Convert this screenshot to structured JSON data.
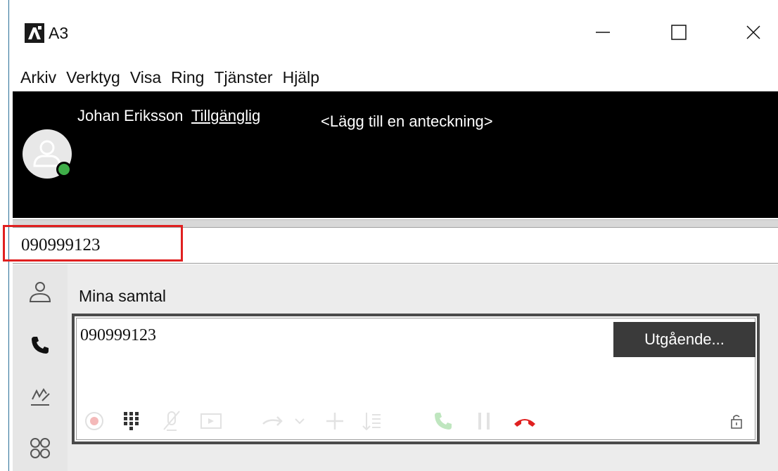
{
  "window": {
    "title": "A3",
    "controls": [
      "minimize-icon",
      "maximize-icon",
      "close-icon"
    ]
  },
  "menu": {
    "items": [
      {
        "label": "Arkiv"
      },
      {
        "label": "Verktyg"
      },
      {
        "label": "Visa"
      },
      {
        "label": "Ring"
      },
      {
        "label": "Tjänster"
      },
      {
        "label": "Hjälp"
      }
    ]
  },
  "user": {
    "name": "Johan Eriksson",
    "status": "Tillgänglig",
    "note_placeholder": "<Lägg till en anteckning>",
    "status_color": "#3fae49"
  },
  "dial": {
    "number": "090999123"
  },
  "nav": {
    "icons": [
      "contacts-icon",
      "phone-icon",
      "signature-icon",
      "groups-icon"
    ]
  },
  "calls": {
    "section_title": "Mina samtal",
    "items": [
      {
        "number": "090999123",
        "state": "Utgående..."
      }
    ],
    "toolbar_icons": [
      "record-icon",
      "dialpad-icon",
      "mute-icon",
      "screen-icon",
      "transfer-icon",
      "dropdown-icon",
      "add-call-icon",
      "merge-icon",
      "answer-icon",
      "hold-icon",
      "hangup-icon",
      "lock-icon"
    ]
  },
  "colors": {
    "header_bg": "#000000",
    "highlight": "#e02020",
    "hangup": "#e02020",
    "badge_bg": "#3a3a3a"
  }
}
